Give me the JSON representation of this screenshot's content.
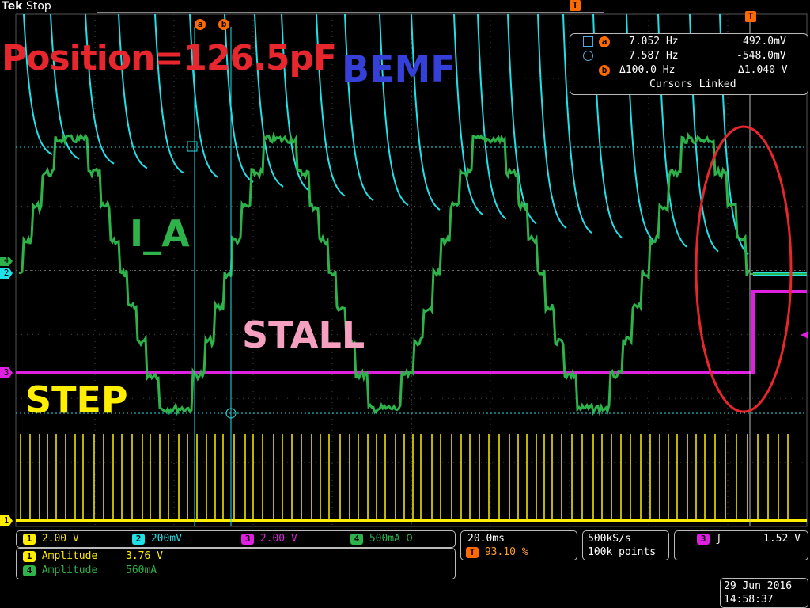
{
  "header": {
    "brand": "Tek",
    "status": "Stop"
  },
  "annotations": {
    "position": "Position=126.5pF",
    "bemf": "BEMF",
    "i_a": "I_A",
    "stall": "STALL",
    "step": "STEP"
  },
  "cursor_markers": {
    "a": "a",
    "b": "b",
    "trigger": "T"
  },
  "cursor_readout": {
    "a_freq": "7.052 Hz",
    "a_val": "492.0mV",
    "b_freq": "7.587 Hz",
    "b_val": "-548.0mV",
    "delta_freq": "Δ100.0 Hz",
    "delta_val": "Δ1.040 V",
    "linked": "Cursors Linked"
  },
  "channels": [
    {
      "num": "1",
      "scale": "2.00 V",
      "color": "#ffee00"
    },
    {
      "num": "2",
      "scale": "200mV",
      "color": "#22e0e8"
    },
    {
      "num": "3",
      "scale": "2.00 V",
      "color": "#e020e0"
    },
    {
      "num": "4",
      "scale": "500mA Ω",
      "color": "#2db34a"
    }
  ],
  "measurements": [
    {
      "ch": "1",
      "name": "Amplitude",
      "value": "3.76 V"
    },
    {
      "ch": "4",
      "name": "Amplitude",
      "value": "560mA"
    }
  ],
  "timebase": {
    "scale": "20.0ms",
    "trigger_pos": "93.10 %"
  },
  "acquisition": {
    "rate": "500kS/s",
    "points": "100k points"
  },
  "trigger": {
    "ch": "3",
    "slope": "ʃ",
    "level": "1.52 V"
  },
  "datetime": {
    "date": "29 Jun 2016",
    "time": "14:58:37"
  },
  "ground_markers": [
    "1",
    "2",
    "3",
    "4"
  ],
  "colors": {
    "ch1": "#ffee00",
    "ch2": "#22e0e8",
    "ch3": "#e020e0",
    "ch4": "#2db34a",
    "annot_circle": "#e8262e",
    "cursor_marker": "#ff6a00"
  }
}
